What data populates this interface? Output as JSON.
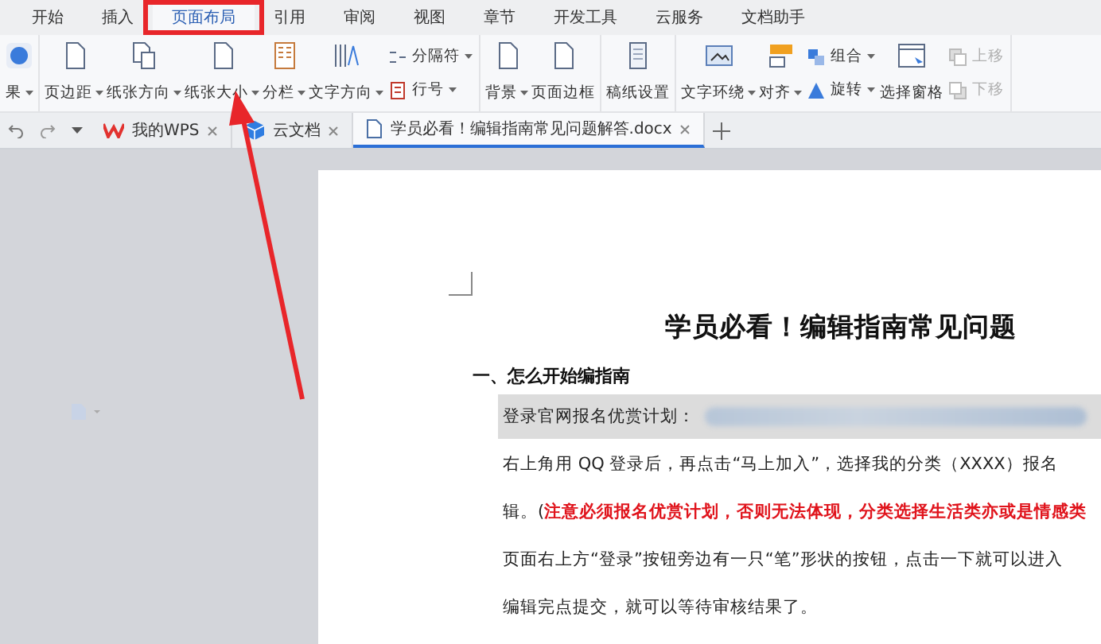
{
  "menu_tabs": [
    {
      "label": "开始",
      "selected": false
    },
    {
      "label": "插入",
      "selected": false
    },
    {
      "label": "页面布局",
      "selected": true
    },
    {
      "label": "引用",
      "selected": false
    },
    {
      "label": "审阅",
      "selected": false
    },
    {
      "label": "视图",
      "selected": false
    },
    {
      "label": "章节",
      "selected": false
    },
    {
      "label": "开发工具",
      "selected": false
    },
    {
      "label": "云服务",
      "selected": false
    },
    {
      "label": "文档助手",
      "selected": false
    }
  ],
  "ribbon_groups": [
    [
      {
        "kind": "large",
        "label": "果",
        "menu": true,
        "disabled": false
      }
    ],
    [
      {
        "kind": "large",
        "label": "页边距",
        "menu": true,
        "disabled": false
      },
      {
        "kind": "large",
        "label": "纸张方向",
        "menu": true,
        "disabled": false
      },
      {
        "kind": "large",
        "label": "纸张大小",
        "menu": true,
        "disabled": false
      },
      {
        "kind": "large",
        "label": "分栏",
        "menu": true,
        "disabled": false
      },
      {
        "kind": "large",
        "label": "文字方向",
        "menu": true,
        "disabled": false
      },
      {
        "kind": "stack",
        "items": [
          {
            "label": "分隔符",
            "menu": true,
            "disabled": false
          },
          {
            "label": "行号",
            "menu": true,
            "disabled": false
          }
        ]
      }
    ],
    [
      {
        "kind": "large",
        "label": "背景",
        "menu": true,
        "disabled": false
      },
      {
        "kind": "large",
        "label": "页面边框",
        "menu": false,
        "disabled": false
      }
    ],
    [
      {
        "kind": "large",
        "label": "稿纸设置",
        "menu": false,
        "disabled": false
      }
    ],
    [
      {
        "kind": "large",
        "label": "文字环绕",
        "menu": true,
        "disabled": false
      },
      {
        "kind": "large",
        "label": "对齐",
        "menu": true,
        "disabled": false
      },
      {
        "kind": "stack",
        "items": [
          {
            "label": "组合",
            "menu": true,
            "disabled": false
          },
          {
            "label": "旋转",
            "menu": true,
            "disabled": false
          }
        ]
      },
      {
        "kind": "large",
        "label": "选择窗格",
        "menu": false,
        "disabled": false
      },
      {
        "kind": "stack",
        "items": [
          {
            "label": "上移",
            "menu": false,
            "disabled": true
          },
          {
            "label": "下移",
            "menu": false,
            "disabled": true
          }
        ]
      }
    ]
  ],
  "doc_tabs": [
    {
      "label": "我的WPS",
      "selected": false
    },
    {
      "label": "云文档",
      "selected": false
    },
    {
      "label": "学员必看！编辑指南常见问题解答.docx",
      "selected": true
    }
  ],
  "document": {
    "title": "学员必看！编辑指南常见问题",
    "heading": "一、怎么开始编指南",
    "paragraphs": [
      {
        "kind": "redacted",
        "text": "登录官网报名优赏计划："
      },
      {
        "kind": "plain",
        "text": "右上角用 QQ 登录后，再点击“马上加入”，选择我的分类（XXXX）报名"
      },
      {
        "kind": "note",
        "text": "辑。(",
        "emphasis": "注意必须报名优赏计划，否则无法体现，分类选择生活类亦或是情感类"
      },
      {
        "kind": "plain",
        "text": "页面右上方“登录”按钮旁边有一只“笔”形状的按钮，点击一下就可以进入"
      },
      {
        "kind": "plain",
        "text": "编辑完点提交，就可以等待审核结果了。"
      }
    ]
  }
}
